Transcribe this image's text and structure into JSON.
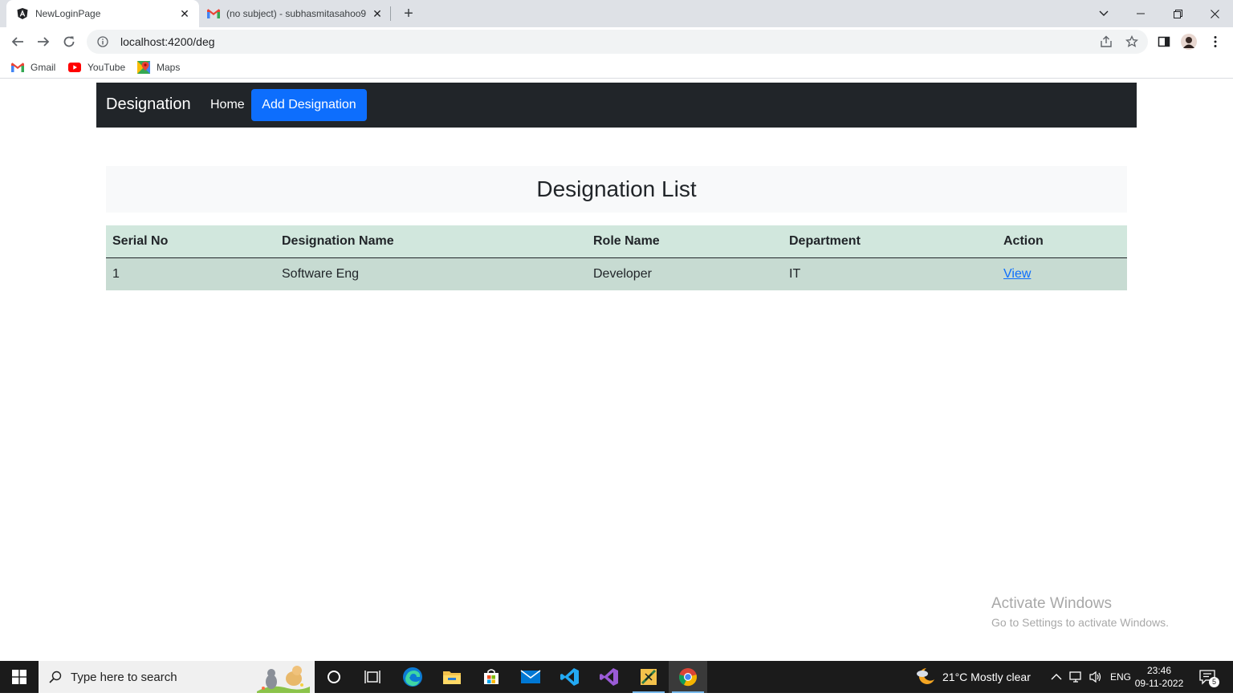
{
  "browser": {
    "tabs": [
      {
        "title": "NewLoginPage",
        "icon": "angular-icon",
        "active": true
      },
      {
        "title": "(no subject) - subhasmitasahoo9",
        "icon": "gmail-icon",
        "active": false
      }
    ],
    "url": "localhost:4200/deg",
    "bookmarks": [
      {
        "label": "Gmail",
        "icon": "gmail-icon"
      },
      {
        "label": "YouTube",
        "icon": "youtube-icon"
      },
      {
        "label": "Maps",
        "icon": "maps-icon"
      }
    ]
  },
  "navbar": {
    "brand": "Designation",
    "home": "Home",
    "add": "Add Designation"
  },
  "page": {
    "title": "Designation List"
  },
  "table": {
    "headers": [
      "Serial No",
      "Designation Name",
      "Role Name",
      "Department",
      "Action"
    ],
    "rows": [
      {
        "serial": "1",
        "designation": "Software Eng",
        "role": "Developer",
        "department": "IT",
        "action": "View"
      }
    ]
  },
  "watermark": {
    "line1": "Activate Windows",
    "line2": "Go to Settings to activate Windows."
  },
  "taskbar": {
    "search_placeholder": "Type here to search",
    "weather": "21°C  Mostly clear",
    "language": "ENG",
    "time": "23:46",
    "date": "09-11-2022",
    "notification_count": "5"
  },
  "colors": {
    "navbar_bg": "#212529",
    "primary": "#0d6efd",
    "table_header_bg": "#d1e7dd",
    "table_row_bg": "#c7dbd2"
  }
}
